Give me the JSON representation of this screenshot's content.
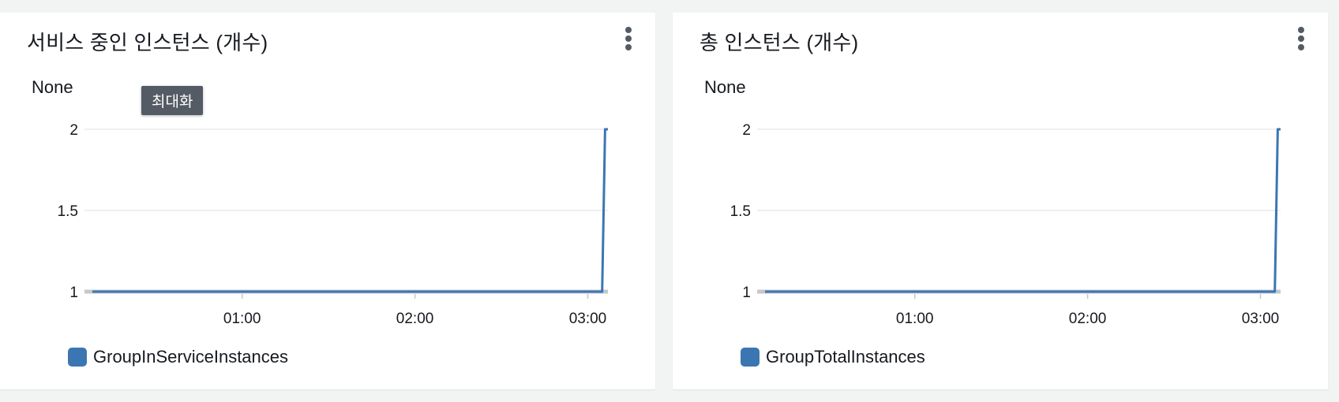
{
  "widgets": [
    {
      "title": "서비스 중인 인스턴스 (개수)",
      "unit_label": "None",
      "tooltip": "최대화",
      "legend_label": "GroupInServiceInstances",
      "chart_data": {
        "type": "line",
        "title": "서비스 중인 인스턴스 (개수)",
        "ylabel": "None",
        "ylim": [
          1,
          2
        ],
        "y_ticks": [
          "2",
          "1.5",
          "1"
        ],
        "x_ticks": [
          "01:00",
          "02:00",
          "03:00"
        ],
        "x_range": [
          "00:08",
          "03:07"
        ],
        "series": [
          {
            "name": "GroupInServiceInstances",
            "color": "#3b76b3",
            "x": [
              "00:08",
              "01:00",
              "02:00",
              "03:00",
              "03:05",
              "03:06",
              "03:07"
            ],
            "y": [
              1,
              1,
              1,
              1,
              1,
              2,
              2
            ]
          }
        ]
      }
    },
    {
      "title": "총 인스턴스 (개수)",
      "unit_label": "None",
      "legend_label": "GroupTotalInstances",
      "chart_data": {
        "type": "line",
        "title": "총 인스턴스 (개수)",
        "ylabel": "None",
        "ylim": [
          1,
          2
        ],
        "y_ticks": [
          "2",
          "1.5",
          "1"
        ],
        "x_ticks": [
          "01:00",
          "02:00",
          "03:00"
        ],
        "x_range": [
          "00:08",
          "03:07"
        ],
        "series": [
          {
            "name": "GroupTotalInstances",
            "color": "#3b76b3",
            "x": [
              "00:08",
              "01:00",
              "02:00",
              "03:00",
              "03:05",
              "03:06",
              "03:07"
            ],
            "y": [
              1,
              1,
              1,
              1,
              1,
              2,
              2
            ]
          }
        ]
      }
    }
  ],
  "colors": {
    "series": "#3b76b3",
    "grid": "#e9ebed",
    "axis_bar": "#c4c7cc"
  },
  "icons": {
    "widget_menu": "vertical-ellipsis-icon"
  }
}
